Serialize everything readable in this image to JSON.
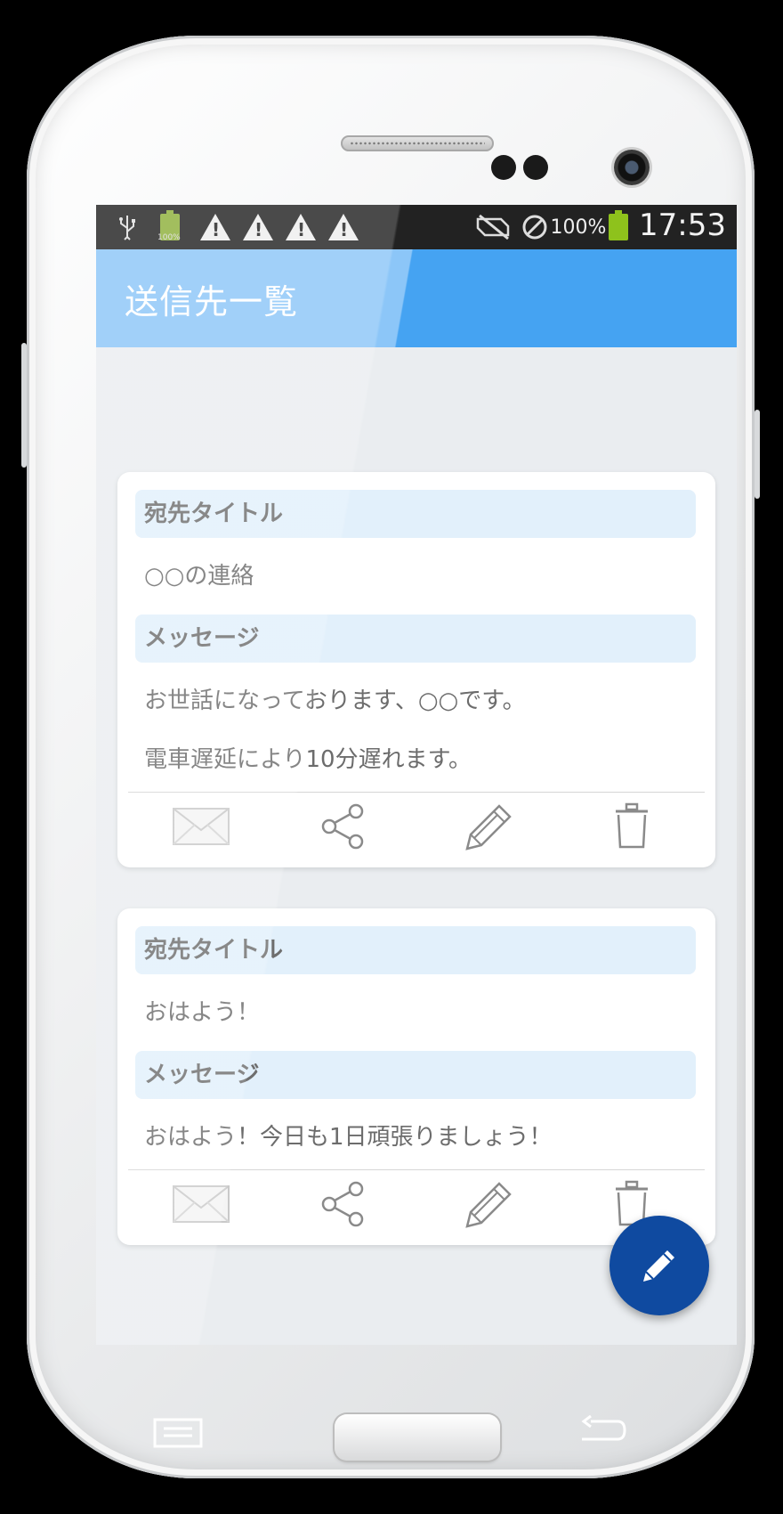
{
  "statusbar": {
    "battery_percent": "100%",
    "time": "17:53",
    "icons": [
      "usb-icon",
      "battery-charging-icon",
      "warning-icon",
      "warning-icon",
      "warning-icon",
      "warning-icon",
      "no-sim-icon",
      "blocked-icon",
      "battery-icon"
    ]
  },
  "appbar": {
    "title": "送信先一覧"
  },
  "cards": [
    {
      "title_label": "宛先タイトル",
      "title_value": "○○の連絡",
      "message_label": "メッセージ",
      "message_lines": [
        "お世話になっております、○○です。",
        "電車遅延により10分遅れます。"
      ]
    },
    {
      "title_label": "宛先タイトル",
      "title_value": "おはよう！",
      "message_label": "メッセージ",
      "message_lines": [
        "おはよう！今日も1日頑張りましょう！"
      ]
    }
  ],
  "actions": [
    "mail-icon",
    "share-icon",
    "edit-icon",
    "trash-icon"
  ],
  "fab": {
    "icon": "edit-icon"
  },
  "colors": {
    "appbar_light": "#8cc6f8",
    "appbar": "#45a3f2",
    "fab": "#0f4aa0",
    "section_bg": "#e2f0fb"
  }
}
